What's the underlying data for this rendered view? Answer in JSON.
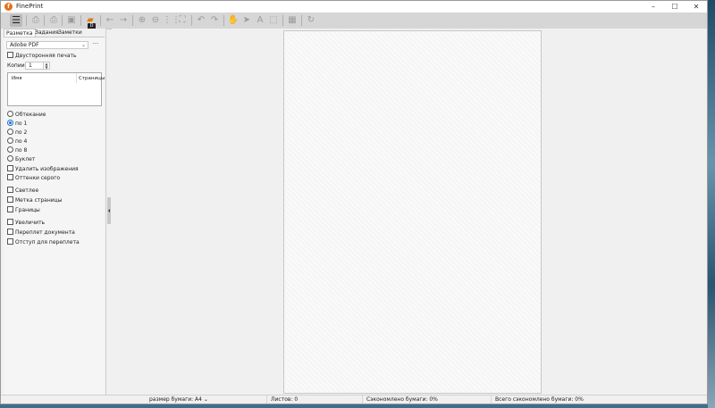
{
  "window": {
    "title": "FinePrint",
    "controls": {
      "minimize": "–",
      "maximize": "☐",
      "close": "✕"
    }
  },
  "toolbar": {
    "badge": "D"
  },
  "tabs": [
    {
      "label": "Разметка"
    },
    {
      "label": "Задания"
    },
    {
      "label": "Заметки"
    }
  ],
  "printer": {
    "selected": "Adobe PDF",
    "more": "···"
  },
  "options": {
    "duplex": "Двусторонняя печать",
    "copies_label": "Копии:",
    "copies_value": "1",
    "layout": {
      "wrap": "Обтекание",
      "n1": "по 1",
      "n2": "по 2",
      "n4": "по 4",
      "n8": "по 8",
      "booklet": "Буклет"
    },
    "remove_images": "Удалить изображения",
    "grayscale": "Оттенки серого",
    "lighter": "Светлее",
    "page_label": "Метка страницы",
    "borders": "Границы",
    "enlarge": "Увеличить",
    "binding": "Переплет документа",
    "gutter": "Отступ для переплета"
  },
  "filelist": {
    "col_name": "Имя",
    "col_pages": "Страницы"
  },
  "status": {
    "paper_size": "размер бумаги: A4",
    "sheets": "Листов: 0",
    "saved": "Сэкономлено бумаги: 0%",
    "total_saved": "Всего сэкономлено бумаги: 0%"
  }
}
